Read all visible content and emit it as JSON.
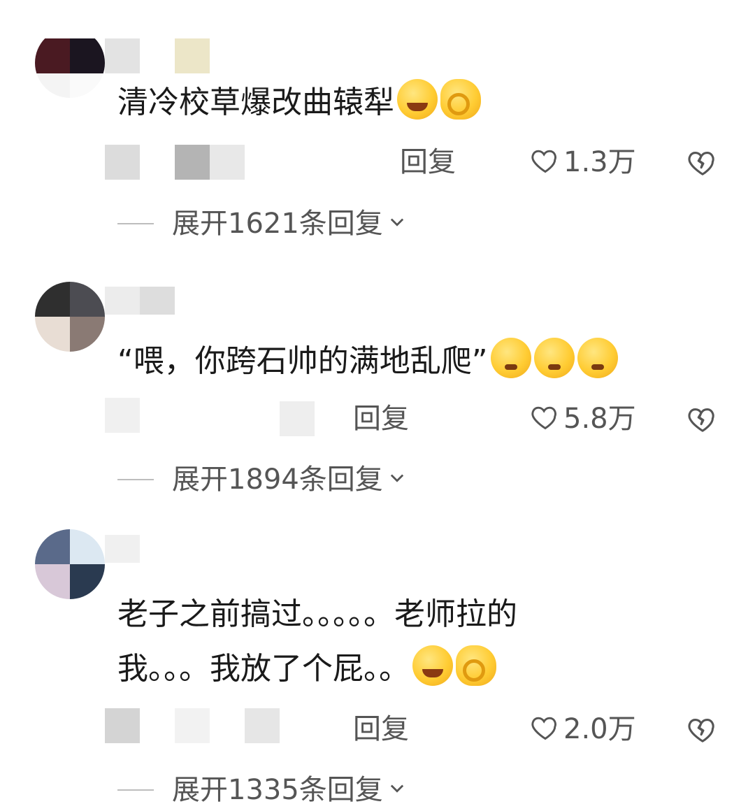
{
  "comments": [
    {
      "text": "清冷校草爆改曲辕犁",
      "emojis": [
        "laugh-cry-emoji",
        "ok-hand-emoji"
      ],
      "reply_label": "回复",
      "likes": "1.3万",
      "expand": "展开1621条回复"
    },
    {
      "text": "“喂，你跨石帅的满地乱爬”",
      "emojis": [
        "pleading-face-emoji",
        "pleading-face-emoji",
        "pleading-face-emoji"
      ],
      "reply_label": "回复",
      "likes": "5.8万",
      "expand": "展开1894条回复"
    },
    {
      "text_line1": "老子之前搞过。。。。。老师拉的",
      "text_line2": "我。。。我放了个屁。。",
      "emojis": [
        "laugh-cry-emoji",
        "ok-hand-emoji"
      ],
      "reply_label": "回复",
      "likes": "2.0万",
      "expand": "展开1335条回复"
    }
  ],
  "colors": {
    "text": "#1a1a1a",
    "meta": "#555555",
    "divider": "#bdbdbd",
    "background": "#ffffff"
  }
}
